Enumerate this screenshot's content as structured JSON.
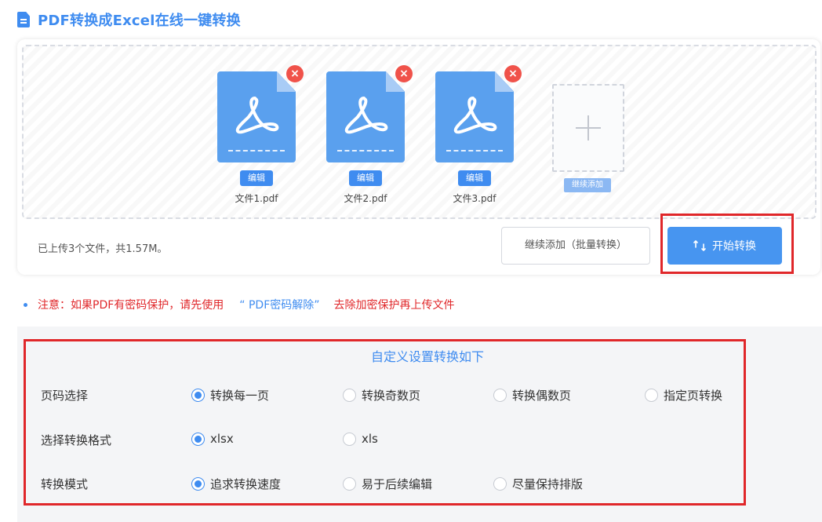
{
  "header": {
    "title": "PDF转换成Excel在线一键转换",
    "icon": "document-icon"
  },
  "files": [
    {
      "name": "文件1.pdf",
      "edit_label": "编辑",
      "remove_label": "×"
    },
    {
      "name": "文件2.pdf",
      "edit_label": "编辑",
      "remove_label": "×"
    },
    {
      "name": "文件3.pdf",
      "edit_label": "编辑",
      "remove_label": "×"
    }
  ],
  "add_tile": {
    "label": "继续添加",
    "icon": "plus-icon"
  },
  "status": {
    "text": "已上传3个文件，共1.57M。"
  },
  "actions": {
    "continue_label": "继续添加（批量转换）",
    "start_label": "开始转换",
    "start_icon": "swap-icon"
  },
  "notice": {
    "prefix": "注意：如果PDF有密码保护，请先使用",
    "link": "“ PDF密码解除”",
    "suffix": "去除加密保护再上传文件"
  },
  "settings": {
    "title": "自定义设置转换如下",
    "groups": [
      {
        "label": "页码选择",
        "options": [
          "转换每一页",
          "转换奇数页",
          "转换偶数页",
          "指定页转换"
        ],
        "selected": 0
      },
      {
        "label": "选择转换格式",
        "options": [
          "xlsx",
          "xls"
        ],
        "selected": 0
      },
      {
        "label": "转换模式",
        "options": [
          "追求转换速度",
          "易于后续编辑",
          "尽量保持排版"
        ],
        "selected": 0
      }
    ]
  },
  "colors": {
    "accent": "#3f8cf0",
    "danger": "#e0272a",
    "file_blue": "#5aa0ee"
  }
}
